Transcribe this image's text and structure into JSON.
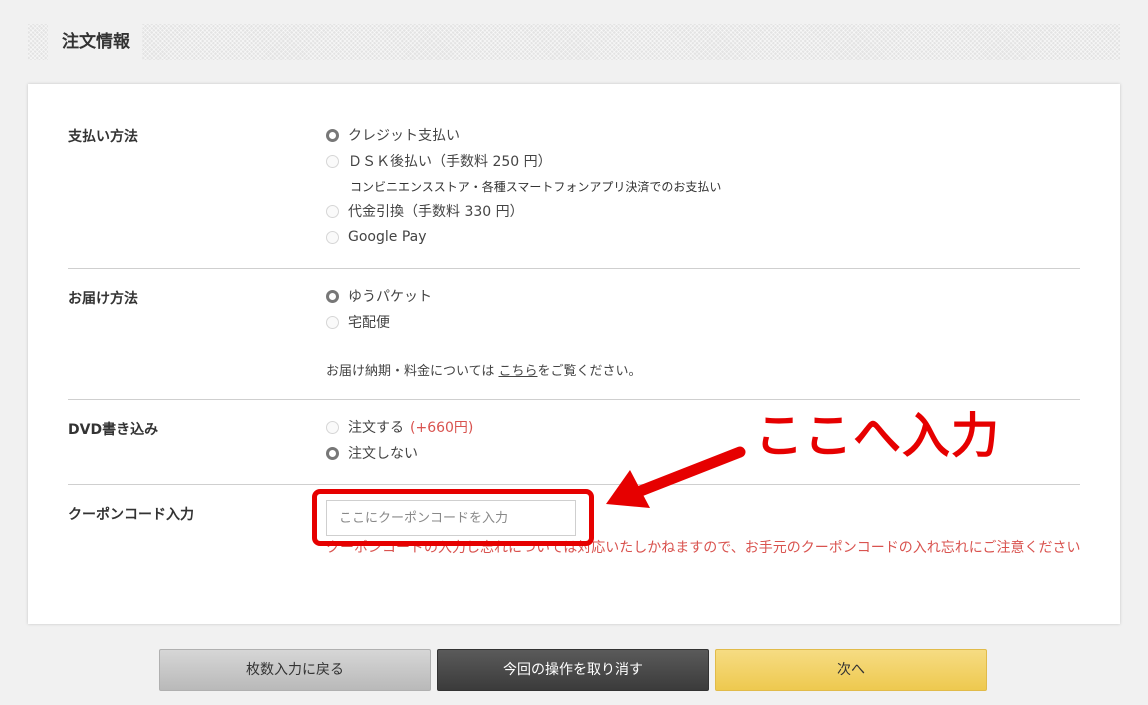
{
  "header": {
    "title": "注文情報"
  },
  "payment": {
    "label": "支払い方法",
    "options": [
      {
        "label": "クレジット支払い",
        "checked": true
      },
      {
        "label": "ＤＳＫ後払い（手数料 250 円）",
        "checked": false
      },
      {
        "label": "代金引換（手数料 330 円）",
        "checked": false
      },
      {
        "label": "Google Pay",
        "checked": false
      }
    ],
    "dsk_sub": "コンビニエンスストア・各種スマートフォンアプリ決済でのお支払い"
  },
  "delivery": {
    "label": "お届け方法",
    "options": [
      {
        "label": "ゆうパケット",
        "checked": true
      },
      {
        "label": "宅配便",
        "checked": false
      }
    ],
    "note_prefix": "お届け納期・料金については ",
    "note_link": "こちら",
    "note_suffix": "をご覧ください。"
  },
  "dvd": {
    "label": "DVD書き込み",
    "options": [
      {
        "label": "注文する",
        "extra": "(+660円)",
        "checked": false
      },
      {
        "label": "注文しない",
        "checked": true
      }
    ]
  },
  "coupon": {
    "label": "クーポンコード入力",
    "placeholder": "ここにクーポンコードを入力",
    "value": "",
    "warning": "クーポンコードの入力し忘れについては対応いたしかねますので、お手元のクーポンコードの入れ忘れにご注意ください"
  },
  "annotation": {
    "text": "ここへ入力",
    "color": "#e60000"
  },
  "buttons": {
    "back": "枚数入力に戻る",
    "cancel": "今回の操作を取り消す",
    "next": "次へ"
  }
}
